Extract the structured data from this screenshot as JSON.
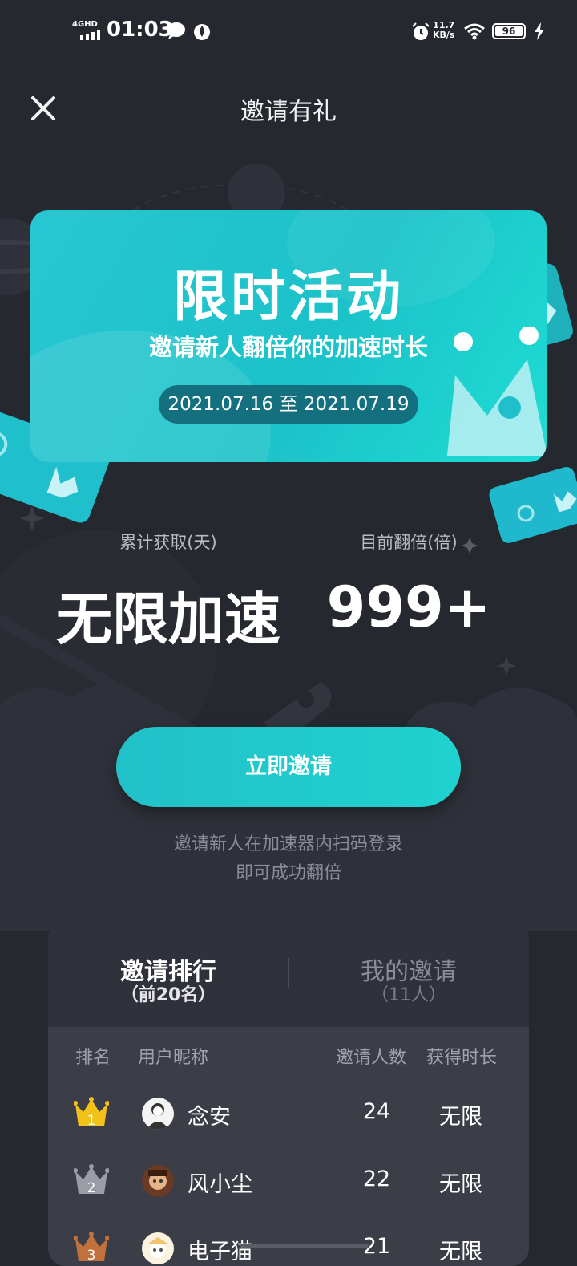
{
  "status_bar": {
    "network": "4GHD",
    "time": "01:03",
    "speed_value": "11.7",
    "speed_unit": "KB/s",
    "battery": "96"
  },
  "header": {
    "title": "邀请有礼"
  },
  "banner": {
    "title": "限时活动",
    "subtitle": "邀请新人翻倍你的加速时长",
    "date_range": "2021.07.16 至 2021.07.19"
  },
  "stats": {
    "accumulated_label": "累计获取(天)",
    "accumulated_value": "无限加速",
    "multiplier_label": "目前翻倍(倍)",
    "multiplier_value": "999+"
  },
  "invite_button": "立即邀请",
  "hint_lines": [
    "邀请新人在加速器内扫码登录",
    "即可成功翻倍"
  ],
  "tabs": [
    {
      "title": "邀请排行",
      "sub": "（前20名）",
      "active": true
    },
    {
      "title": "我的邀请",
      "sub": "（11人）",
      "active": false
    }
  ],
  "table": {
    "headers": [
      "排名",
      "用户昵称",
      "邀请人数",
      "获得时长"
    ],
    "rows": [
      {
        "rank": "1",
        "nickname": "念安",
        "invites": "24",
        "duration": "无限"
      },
      {
        "rank": "2",
        "nickname": "风小尘",
        "invites": "22",
        "duration": "无限"
      },
      {
        "rank": "3",
        "nickname": "电子猫",
        "invites": "21",
        "duration": "无限"
      }
    ]
  },
  "colors": {
    "background": "#262830",
    "accent": "#1fc6cc",
    "gold": "#f3c21a",
    "silver": "#9b9da6",
    "bronze": "#c0713c"
  }
}
